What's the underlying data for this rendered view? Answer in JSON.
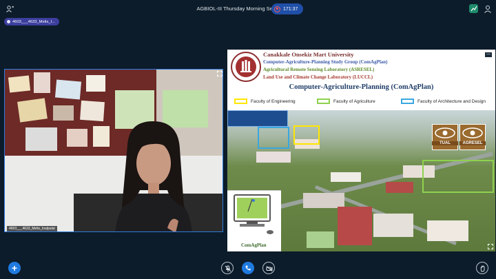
{
  "session": {
    "title": "AGBIOL-III Thursday Morning Session 19-46",
    "timer": "171:37"
  },
  "presenter": {
    "chip_label": "4603___4633_Melis_I...",
    "video_name": "4603___4633_Melis_Inalpulat"
  },
  "slide": {
    "university": "Canakkale Onsekiz Mart University",
    "line2": "Computer-Agriculture-Planning Study Group (ComAgPlan)",
    "line3": "Agricultural Remote Sensing Laboratory (ASRESEL)",
    "line4": "Land Use and Climate Change Laboratory (LUCCL)",
    "title": "Computer-Agriculture-Planning (ComAgPlan)",
    "legend": [
      {
        "label": "Faculty of Engineering",
        "color": "#ffe600"
      },
      {
        "label": "Faculty of Agriculture",
        "color": "#8fd14f"
      },
      {
        "label": "Faculty of Architecture and Design",
        "color": "#3aa7e0"
      }
    ],
    "logos": [
      "TUAL",
      "AGRESEL"
    ],
    "comag_caption": "ComAgPlan"
  },
  "colors": {
    "background": "#0d1c2a",
    "accent_blue": "#1f7ae0",
    "active_border": "#2f7de1"
  },
  "icons": {
    "participants": "participants-icon",
    "record": "record-icon",
    "stats": "stats-icon",
    "person": "person-icon",
    "add": "add-icon",
    "mic": "mic-off-icon",
    "phone": "phone-icon",
    "camera": "camera-off-icon",
    "raise_hand": "raise-hand-icon",
    "expand": "expand-icon"
  }
}
